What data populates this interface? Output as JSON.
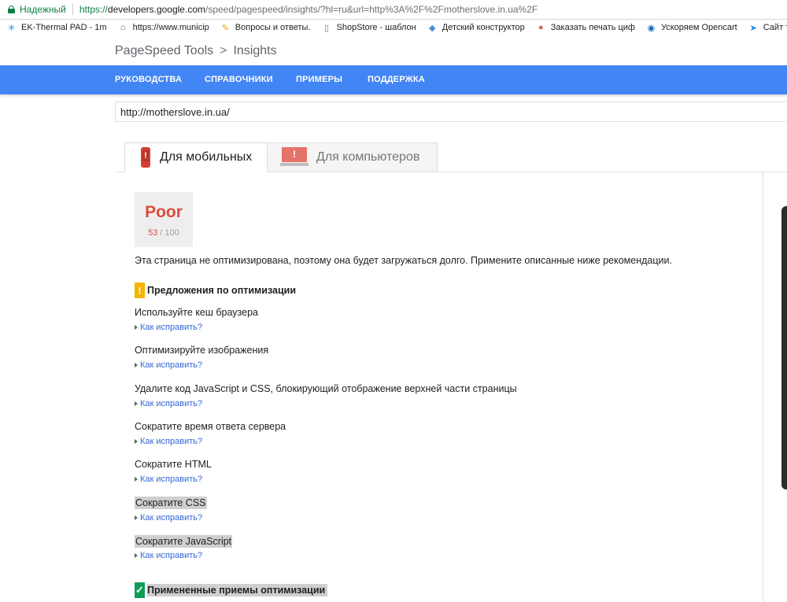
{
  "browser": {
    "secure_label": "Надежный",
    "url_scheme": "https://",
    "url_host": "developers.google.com",
    "url_rest": "/speed/pagespeed/insights/?hl=ru&url=http%3A%2F%2Fmotherslove.in.ua%2F"
  },
  "bookmarks": [
    {
      "label": "EK-Thermal PAD - 1m",
      "icon": "snowflake-icon"
    },
    {
      "label": "https://www.municip",
      "icon": "building-icon"
    },
    {
      "label": "Вопросы и ответы.",
      "icon": "edit-icon"
    },
    {
      "label": "ShopStore - шаблон",
      "icon": "document-icon"
    },
    {
      "label": "Детский конструктор",
      "icon": "cube-icon"
    },
    {
      "label": "Заказать печать циф",
      "icon": "star-icon"
    },
    {
      "label": "Ускоряем Opencart",
      "icon": "opencart-icon"
    },
    {
      "label": "Сайт тормозит как с",
      "icon": "speed-icon"
    }
  ],
  "header": {
    "product": "PageSpeed Tools",
    "separator": ">",
    "section": "Insights"
  },
  "nav": [
    "РУКОВОДСТВА",
    "СПРАВОЧНИКИ",
    "ПРИМЕРЫ",
    "ПОДДЕРЖКА"
  ],
  "url_input": {
    "value": "http://motherslove.in.ua/"
  },
  "tabs": {
    "mobile": "Для мобильных",
    "desktop": "Для компьютеров"
  },
  "score": {
    "label": "Poor",
    "value": "53",
    "max": "/ 100"
  },
  "summary": "Эта страница не оптимизирована, поэтому она будет загружаться долго. Примените описанные ниже рекомендации.",
  "suggestions_title": "Предложения по оптимизации",
  "how_to_fix": "Как исправить?",
  "rules": [
    "Используйте кеш браузера",
    "Оптимизируйте изображения",
    "Удалите код JavaScript и CSS, блокирующий отображение верхней части страницы",
    "Сократите время ответа сервера",
    "Сократите HTML",
    "Сократите CSS",
    "Сократите JavaScript"
  ],
  "applied_title": "Примененные приемы оптимизации",
  "colors": {
    "accent_blue": "#4285f4",
    "poor_red": "#dd4b39",
    "warning": "#f4b400",
    "ok": "#0f9d58",
    "link": "#3367d6"
  }
}
